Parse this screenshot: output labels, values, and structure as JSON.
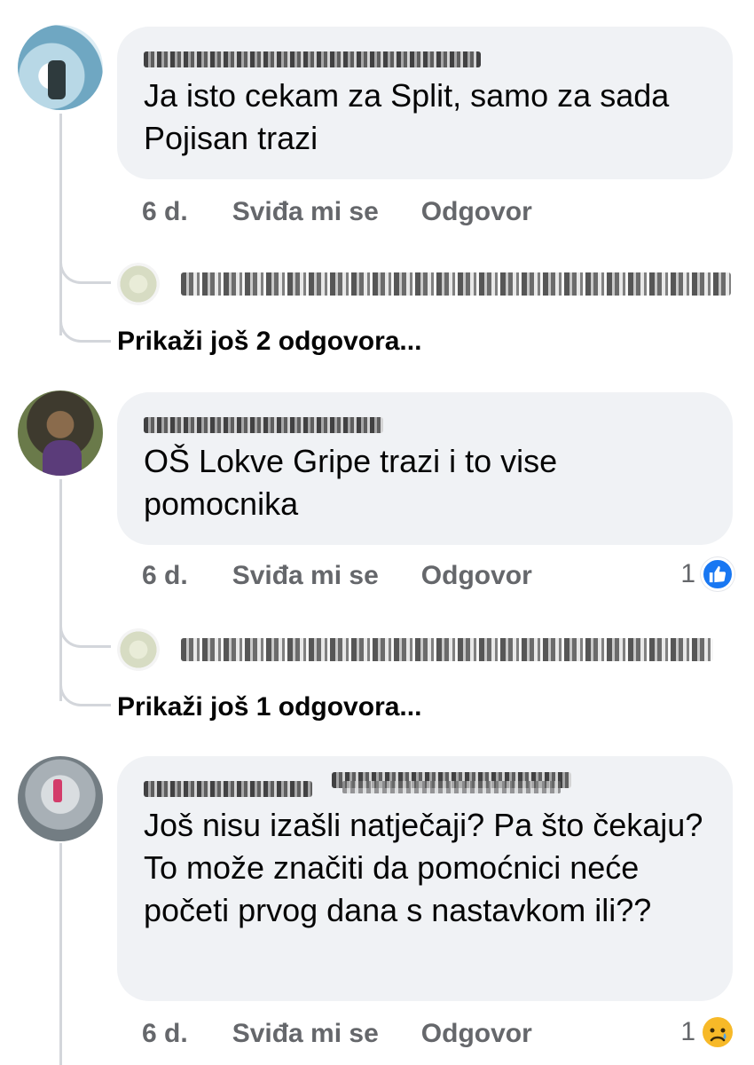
{
  "comments": [
    {
      "author_blurred": true,
      "text": "Ja isto cekam za Split, samo za sada Pojisan trazi",
      "time": "6 d.",
      "like_label": "Sviđa mi se",
      "reply_label": "Odgovor",
      "reaction": null,
      "more_replies": "Prikaži još 2 odgovora..."
    },
    {
      "author_blurred": true,
      "text": "OŠ Lokve Gripe trazi i to vise pomocnika",
      "time": "6 d.",
      "like_label": "Sviđa mi se",
      "reply_label": "Odgovor",
      "reaction": {
        "count": "1",
        "icon": "like-icon",
        "color": "#1877f2"
      },
      "more_replies": "Prikaži još 1 odgovora..."
    },
    {
      "author_blurred": true,
      "text": "Još nisu izašli natječaji? Pa što čekaju? To može značiti da pomoćnici neće početi prvog dana s nastavkom ili??",
      "time": "6 d.",
      "like_label": "Sviđa mi se",
      "reply_label": "Odgovor",
      "reaction": {
        "count": "1",
        "icon": "sad-icon",
        "color": "#f7b928"
      }
    }
  ],
  "colors": {
    "bubble": "#f0f2f5",
    "meta": "#65676b",
    "thread": "#d3d6db",
    "like_blue": "#1877f2"
  }
}
